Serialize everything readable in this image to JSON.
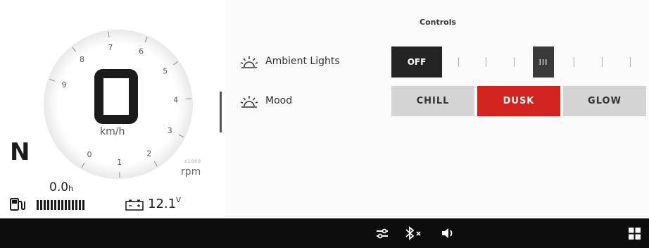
{
  "cluster": {
    "speed": "0",
    "speed_unit": "km/h",
    "gear": "N",
    "trip_value": "0.0",
    "trip_unit": "h",
    "voltage_value": "12.1",
    "voltage_unit": "V",
    "rpm_unit": "rpm",
    "rpm_multiplier": "x1000",
    "tach_ticks": [
      "0",
      "1",
      "2",
      "3",
      "4",
      "5",
      "6",
      "7",
      "8",
      "9"
    ]
  },
  "controls": {
    "title": "Controls",
    "ambient_lights": {
      "label": "Ambient Lights",
      "off_label": "OFF",
      "active_level_label": "III"
    },
    "mood": {
      "label": "Mood",
      "options": [
        "CHILL",
        "DUSK",
        "GLOW"
      ],
      "selected": "DUSK"
    }
  },
  "colors": {
    "accent": "#d2231f",
    "status_bar": "#0d0d0d",
    "dark_button": "#242424",
    "light_button": "#d4d4d4"
  },
  "status_bar": {
    "icons": [
      "sliders-icon",
      "bluetooth-off-icon",
      "volume-icon",
      "apps-grid-icon"
    ]
  }
}
